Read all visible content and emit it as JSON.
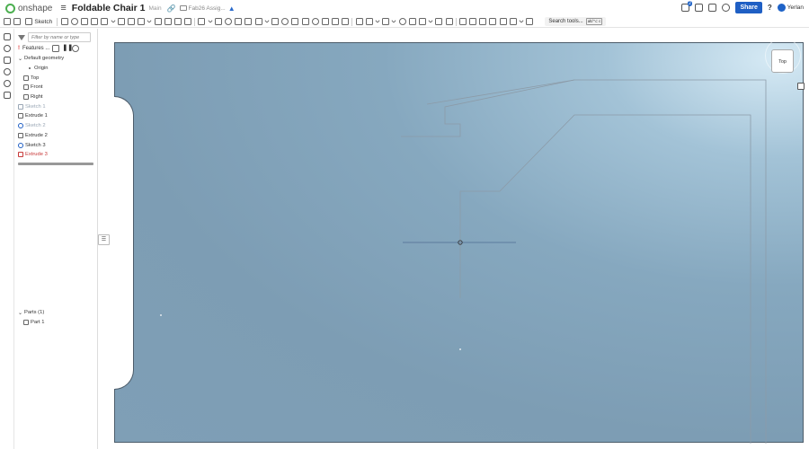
{
  "app": {
    "name": "onshape"
  },
  "document": {
    "title": "Foldable Chair 1",
    "branch": "Main",
    "folder": "Fab26 Assig..."
  },
  "header": {
    "notifications_count": "2",
    "share_label": "Share",
    "help_label": "?",
    "user_name": "Yerlan"
  },
  "toolbar": {
    "sketch_label": "Sketch",
    "search_label": "Search tools...",
    "search_shortcut": "alt/⌥ c"
  },
  "feature_panel": {
    "filter_placeholder": "Filter by name or type",
    "header_label": "Features ...",
    "tree": [
      {
        "label": "Default geometry",
        "icon": "chevron-down-icon",
        "state": "normal"
      },
      {
        "label": "Origin",
        "icon": "origin-point-icon",
        "state": "normal"
      },
      {
        "label": "Top",
        "icon": "plane-icon",
        "state": "normal"
      },
      {
        "label": "Front",
        "icon": "plane-icon",
        "state": "normal"
      },
      {
        "label": "Right",
        "icon": "plane-icon",
        "state": "normal"
      },
      {
        "label": "Sketch 1",
        "icon": "sketch-icon",
        "state": "muted"
      },
      {
        "label": "Extrude 1",
        "icon": "extrude-icon",
        "state": "normal"
      },
      {
        "label": "Sketch 2",
        "icon": "sketch-icon",
        "state": "muted"
      },
      {
        "label": "Extrude 2",
        "icon": "extrude-icon",
        "state": "normal"
      },
      {
        "label": "Sketch 3",
        "icon": "sketch-icon",
        "state": "normal"
      },
      {
        "label": "Extrude 3",
        "icon": "extrude-icon",
        "state": "error"
      }
    ],
    "parts_label": "Parts (1)",
    "parts": [
      {
        "label": "Part 1",
        "icon": "part-icon"
      }
    ]
  },
  "viewport": {
    "view_cube_label": "Top",
    "colors": {
      "background": "#7f9fb6",
      "sketch_line": "#8c9ba8",
      "accent": "#1f5fc4"
    }
  }
}
